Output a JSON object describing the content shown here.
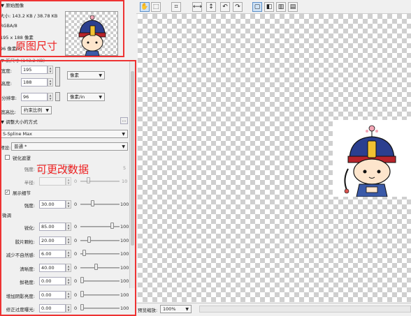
{
  "original": {
    "header": "▼ 原始图像",
    "size_line": "大小: 143.2 KB / 38.78 KB",
    "format_line": "RGBA/8",
    "dims_line": "195 x 188 像素",
    "dpi_line": "96 像素/in",
    "new_size_header": "▼ 新尺寸 (143.2 KB)"
  },
  "annotations": {
    "original_size": "原图尺寸",
    "editable_data": "可更改数据"
  },
  "size_fields": {
    "width_label": "宽度:",
    "width_value": "195",
    "height_label": "高度:",
    "height_value": "188",
    "unit": "像素",
    "resolution_label": "分辨率:",
    "resolution_value": "96",
    "resolution_unit": "像素/in",
    "aspect_label": "宽高比:",
    "aspect_value": "约束比例"
  },
  "resize_method": {
    "header": "▼ 调整大小的方式",
    "more_button": "...",
    "method": "S-Spline Max",
    "preset_label": "预设:",
    "preset_value": "普通 *"
  },
  "sharpen_mask": {
    "checkbox_label": "锐化遮罩",
    "strength_label": "强度:",
    "strength_zero": "0",
    "strength_max": "5",
    "radius_label": "半径:",
    "radius_zero": "0",
    "radius_max": "10"
  },
  "detail": {
    "checkbox_label": "展示细节",
    "checked": true,
    "strength_label": "强度:",
    "strength_value": "30.00",
    "zero": "0",
    "max": "100",
    "level": 0.3
  },
  "fine_tune": {
    "header": "微调",
    "rows": [
      {
        "label": "锐化:",
        "value": "85.00",
        "zero": "0",
        "max": "100",
        "level": 0.85
      },
      {
        "label": "胶片颗粒:",
        "value": "20.00",
        "zero": "0",
        "max": "100",
        "level": 0.2
      },
      {
        "label": "减少不自然感:",
        "value": "6.00",
        "zero": "0",
        "max": "100",
        "level": 0.06
      },
      {
        "label": "清晰度:",
        "value": "40.00",
        "zero": "0",
        "max": "100",
        "level": 0.4
      },
      {
        "label": "鲜艳度:",
        "value": "0.00",
        "zero": "0",
        "max": "100",
        "level": 0.0
      },
      {
        "label": "增加阴影亮度:",
        "value": "0.00",
        "zero": "0",
        "max": "100",
        "level": 0.0
      },
      {
        "label": "修正过度曝光:",
        "value": "0.00",
        "zero": "0",
        "max": "100",
        "level": 0.0
      }
    ]
  },
  "toolbar": {
    "hand_icon": "hand-icon",
    "zoom_icon": "zoom-select-icon",
    "crop_icon": "crop-icon",
    "icons": [
      "hand-icon",
      "zoom-select-icon",
      "crop-icon",
      "fit-width-icon",
      "fit-height-icon",
      "undo-icon",
      "redo-icon",
      "single-view-icon",
      "split-vertical-icon",
      "split-dual-icon",
      "split-horizontal-icon"
    ]
  },
  "status": {
    "zoom_label": "预览缩放:",
    "zoom_value": "100%"
  },
  "colors": {
    "annotation": "#e22222",
    "box": "#ee3333"
  }
}
